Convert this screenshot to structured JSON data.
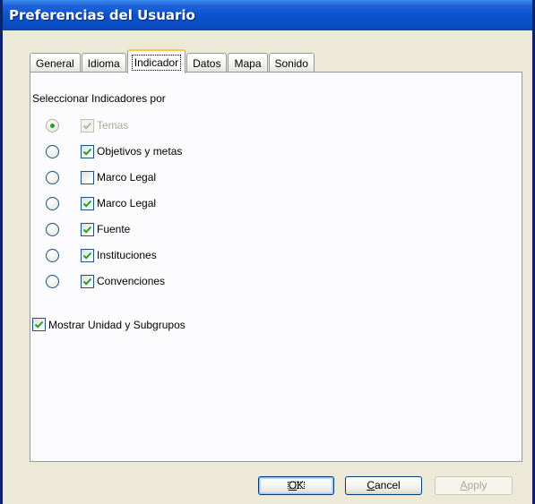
{
  "window": {
    "title": "Preferencias del Usuario"
  },
  "tabs": [
    {
      "label": "General",
      "active": false
    },
    {
      "label": "Idioma",
      "active": false
    },
    {
      "label": "Indicador",
      "active": true
    },
    {
      "label": "Datos",
      "active": false
    },
    {
      "label": "Mapa",
      "active": false
    },
    {
      "label": "Sonido",
      "active": false
    }
  ],
  "indicator": {
    "section_label": "Seleccionar Indicadores por",
    "options": [
      {
        "label": "Temas",
        "radio_checked": true,
        "checkbox_checked": true,
        "disabled": true
      },
      {
        "label": "Objetivos y metas",
        "radio_checked": false,
        "checkbox_checked": true,
        "disabled": false
      },
      {
        "label": "Marco Legal",
        "radio_checked": false,
        "checkbox_checked": false,
        "disabled": false
      },
      {
        "label": "Marco Legal",
        "radio_checked": false,
        "checkbox_checked": true,
        "disabled": false
      },
      {
        "label": "Fuente",
        "radio_checked": false,
        "checkbox_checked": true,
        "disabled": false
      },
      {
        "label": "Instituciones",
        "radio_checked": false,
        "checkbox_checked": true,
        "disabled": false
      },
      {
        "label": "Convenciones",
        "radio_checked": false,
        "checkbox_checked": true,
        "disabled": false
      }
    ],
    "show_unit": {
      "label": "Mostrar Unidad y Subgrupos",
      "checked": true
    }
  },
  "buttons": {
    "ok": {
      "mnemonic": "O",
      "rest": "K"
    },
    "cancel": {
      "mnemonic": "C",
      "rest": "ancel"
    },
    "apply": {
      "mnemonic": "A",
      "rest": "pply",
      "disabled": true
    }
  },
  "colors": {
    "title_bar": "#0a52cf",
    "check_mark": "#21a121",
    "face": "#ece9d8"
  }
}
